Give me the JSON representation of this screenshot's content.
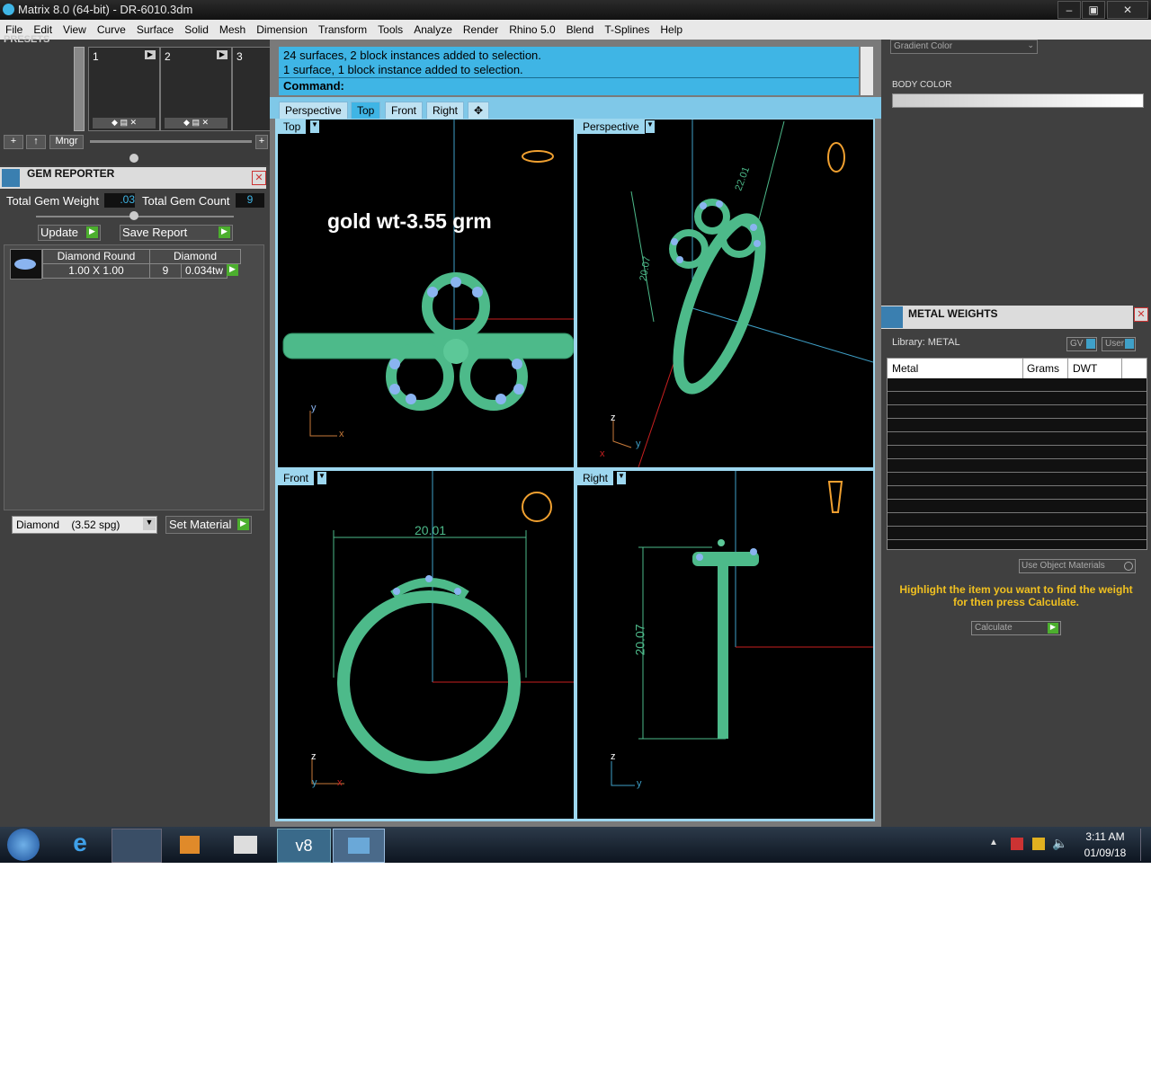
{
  "window": {
    "title": "Matrix 8.0 (64-bit) - DR-6010.3dm",
    "min": "–",
    "max": "▣",
    "close": "✕"
  },
  "menu": [
    "File",
    "Edit",
    "View",
    "Curve",
    "Surface",
    "Solid",
    "Mesh",
    "Dimension",
    "Transform",
    "Tools",
    "Analyze",
    "Render",
    "Rhino 5.0",
    "Blend",
    "T-Splines",
    "Help"
  ],
  "presets": {
    "header": "PRESETS",
    "slots": [
      "1",
      "2",
      "3"
    ],
    "mngr": "Mngr"
  },
  "gem_reporter": {
    "title": "GEM REPORTER",
    "total_weight_label": "Total Gem Weight",
    "total_weight_value": ".03",
    "total_count_label": "Total Gem Count",
    "total_count_value": "9",
    "update": "Update",
    "save_report": "Save Report",
    "row": {
      "shape": "Diamond Round",
      "size": "1.00 X 1.00",
      "material": "Diamond",
      "count": "9",
      "weight": "0.034tw"
    },
    "material_select": "Diamond    (3.52 spg)",
    "set_material": "Set Material"
  },
  "command": {
    "line1": "24 surfaces, 2 block instances added to selection.",
    "line2": "1 surface, 1 block instance added to selection.",
    "prompt": "Command:"
  },
  "tabs": [
    "Perspective",
    "Top",
    "Front",
    "Right",
    "✥"
  ],
  "viewports": {
    "top": {
      "label": "Top",
      "annotation": "gold wt-3.55 grm",
      "axis_y": "y",
      "axis_x": "x"
    },
    "perspective": {
      "label": "Perspective",
      "dim": "20.07",
      "dim2": "22.01",
      "axis_z": "z",
      "axis_y": "y",
      "axis_x": "x"
    },
    "front": {
      "label": "Front",
      "dim": "20.01",
      "axis_z": "z",
      "axis_y": "y",
      "axis_x": "x"
    },
    "right": {
      "label": "Right",
      "dim": "20.07",
      "axis_z": "z",
      "axis_y": "y"
    }
  },
  "right_panel": {
    "gradient": "Gradient Color",
    "body_color": "BODY COLOR",
    "metal_weights": "METAL WEIGHTS",
    "library": "Library: METAL",
    "gv": "GV",
    "user": "User",
    "cols": [
      "Metal",
      "Grams",
      "DWT"
    ],
    "use_object": "Use Object Materials",
    "hint": "Highlight the item you want to find the weight for then press Calculate.",
    "calculate": "Calculate"
  },
  "taskbar": {
    "time": "3:11 AM",
    "date": "01/09/18"
  },
  "colors": {
    "accent": "#3fb5e5",
    "model": "#4dba8a",
    "gem": "#8ab4f0"
  }
}
